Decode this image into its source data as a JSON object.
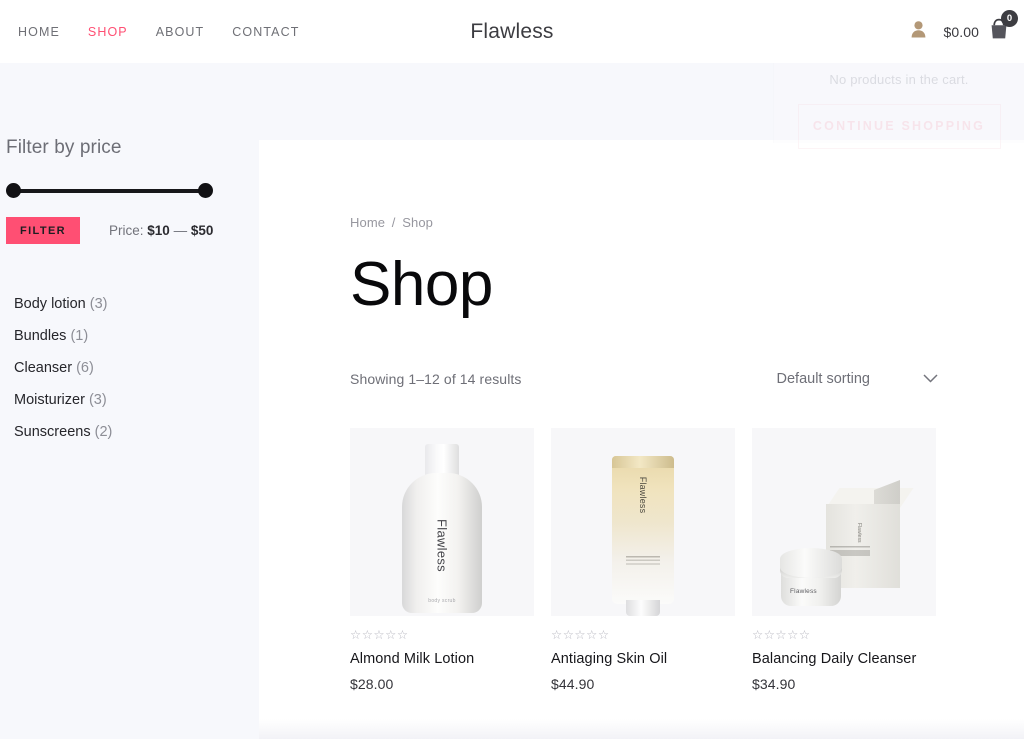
{
  "header": {
    "brand": "Flawless",
    "nav": [
      {
        "label": "HOME",
        "active": false
      },
      {
        "label": "SHOP",
        "active": true
      },
      {
        "label": "ABOUT",
        "active": false
      },
      {
        "label": "CONTACT",
        "active": false
      }
    ],
    "account_icon": "user-icon",
    "cart_icon": "shopping-bag-icon",
    "cart_total": "$0.00",
    "cart_count": "0"
  },
  "cart_dropdown": {
    "empty_message": "No products in the cart.",
    "continue_label": "CONTINUE SHOPPING"
  },
  "sidebar": {
    "filter_title": "Filter by price",
    "filter_button": "FILTER",
    "price_prefix": "Price:",
    "price_min": "$10",
    "price_dash": "—",
    "price_max": "$50",
    "categories": [
      {
        "name": "Body lotion",
        "count": "(3)"
      },
      {
        "name": "Bundles",
        "count": "(1)"
      },
      {
        "name": "Cleanser",
        "count": "(6)"
      },
      {
        "name": "Moisturizer",
        "count": "(3)"
      },
      {
        "name": "Sunscreens",
        "count": "(2)"
      }
    ]
  },
  "main": {
    "breadcrumb_home": "Home",
    "breadcrumb_sep": "/",
    "breadcrumb_current": "Shop",
    "page_title": "Shop",
    "results_text": "Showing 1–12 of 14 results",
    "sorting_value": "Default sorting",
    "sorting_icon": "chevron-down-icon",
    "products": [
      {
        "name": "Almond Milk Lotion",
        "price": "$28.00",
        "stars": "☆☆☆☆☆",
        "image_name": "almond-milk-lotion-bottle",
        "brand_on_pack": "Flawless",
        "sub_on_pack": "body scrub"
      },
      {
        "name": "Antiaging Skin Oil",
        "price": "$44.90",
        "stars": "☆☆☆☆☆",
        "image_name": "antiaging-skin-oil-tube",
        "brand_on_pack": "Flawless",
        "sub_on_pack": ""
      },
      {
        "name": "Balancing Daily Cleanser",
        "price": "$34.90",
        "stars": "☆☆☆☆☆",
        "image_name": "balancing-daily-cleanser-jar",
        "brand_on_pack": "Flawless",
        "sub_on_pack": ""
      }
    ]
  },
  "colors": {
    "accent_pink": "#ff4f73",
    "page_background": "#f7f8fc",
    "content_background": "#ffffff",
    "text_dark": "#16161a",
    "text_muted": "#6e6f77"
  }
}
